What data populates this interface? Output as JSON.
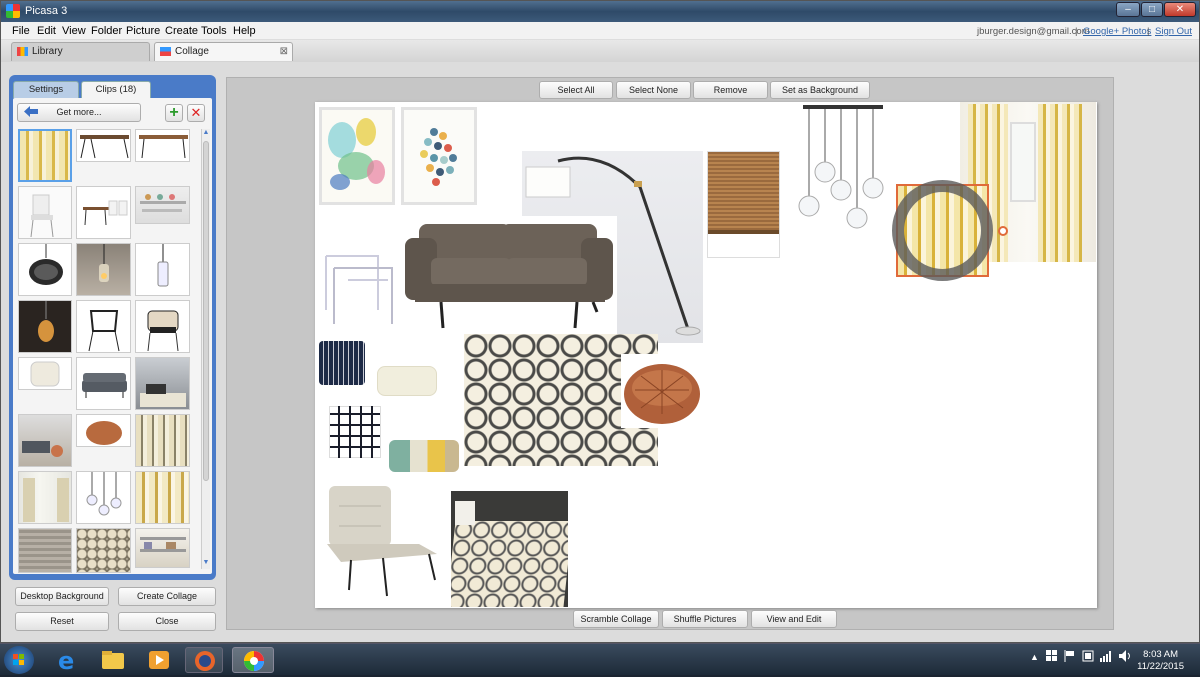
{
  "window": {
    "title": "Picasa 3",
    "controls": [
      "–",
      "□",
      "✕"
    ]
  },
  "menu": [
    "File",
    "Edit",
    "View",
    "Folder",
    "Picture",
    "Create",
    "Tools",
    "Help"
  ],
  "account": {
    "email": "jburger.design@gmail.com",
    "sep1": "|",
    "photos": "Google+ Photos",
    "sep2": "|",
    "signout": "Sign Out"
  },
  "tabs": {
    "library": "Library",
    "collage": "Collage",
    "close": "⊠"
  },
  "left_panel": {
    "tab_settings": "Settings",
    "tab_clips": "Clips (18)",
    "get_more": "Get more...",
    "add": "+",
    "remove": "✕",
    "scroll_up": "▲",
    "scroll_down": "▼"
  },
  "bottom_left_buttons": {
    "desktop": "Desktop Background",
    "create": "Create Collage",
    "reset": "Reset",
    "close": "Close"
  },
  "top_buttons": {
    "select_all": "Select All",
    "select_none": "Select None",
    "remove": "Remove",
    "set_bg": "Set as Background"
  },
  "bottom_buttons": {
    "scramble": "Scramble Collage",
    "shuffle": "Shuffle Pictures",
    "view_edit": "View and Edit"
  },
  "clock": {
    "time": "8:03 AM",
    "date": "11/22/2015"
  },
  "colors": {
    "accent": "#4a7bc8",
    "selection": "#e06a3a",
    "titlebar": "#3c5a7a"
  }
}
